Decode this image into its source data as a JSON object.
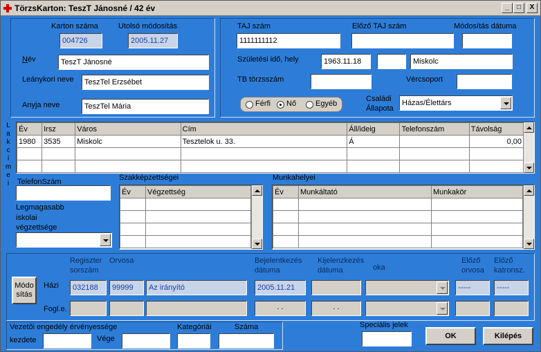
{
  "window": {
    "title": "TörzsKarton: TeszT Jánosné / 42 év",
    "min": "_",
    "max": "□",
    "close": "X"
  },
  "left": {
    "karton_label": "Karton száma",
    "karton_value": "004726",
    "utolso_label": "Utolsó módosítás",
    "utolso_value": "2005.11.27",
    "nev_label": "Név",
    "nev_value": "TeszT Jánosné",
    "leany_label": "Leánykori neve",
    "leany_value": "TeszTel Erzsébet",
    "anyja_label": "Anyja neve",
    "anyja_value": "TeszTel Mária"
  },
  "right": {
    "taj_label": "TAJ szám",
    "taj_value": "1111111112",
    "elozo_taj_label": "Előző TAJ szám",
    "elozo_taj_value": "",
    "mod_datum_label": "Módosítás dátuma",
    "mod_datum_value": "",
    "szul_label": "Születési idő, hely",
    "szul_datum": "1963.11.18",
    "szul_mid": "",
    "szul_hely": "Miskolc",
    "tb_label": "TB törzsszám",
    "tb_value": "",
    "ver_label": "Vércsoport",
    "ver_value": "",
    "radio_ferfi": "Férfi",
    "radio_no": "Nő",
    "radio_egyeb": "Egyéb",
    "csaladi_label1": "Családi",
    "csaladi_label2": "Állapota",
    "csaladi_value": "Házas/Élettárs"
  },
  "lakcimei_label": [
    "L",
    "a",
    "k",
    "c",
    "í",
    "m",
    "e",
    "i"
  ],
  "address_table": {
    "headers": [
      "Év",
      "Irsz",
      "Város",
      "Cím",
      "Áll/ideig",
      "Telefonszám",
      "Távolság"
    ],
    "rows": [
      [
        "1980",
        "3535",
        "Miskolc",
        "Tesztelok u. 33.",
        "Á",
        "",
        "0,00"
      ]
    ]
  },
  "phone": {
    "label": "TelefonSzám",
    "value": ""
  },
  "edu": {
    "label1": "Legmagasabb",
    "label2": "iskolai",
    "label3": "végzettsége",
    "value": ""
  },
  "szakk": {
    "title": "Szakképzettségei",
    "headers": [
      "Év",
      "Végzettség"
    ]
  },
  "munka": {
    "title": "Munkahelyei",
    "headers": [
      "Év",
      "Munkáltató",
      "Munkakör"
    ]
  },
  "regiszter": {
    "mod_btn_1": "Módo",
    "mod_btn_2": "sítás",
    "reg_label1": "Regiszter",
    "reg_label2": "sorszám",
    "orvosa_label": "Orvosa",
    "bej_label1": "Bejelentkezés",
    "bej_label2": "dátuma",
    "kij_label1": "Kijelenzkezés",
    "kij_label2": "dátuma",
    "oka_label": "oka",
    "elozo_orv1": "Előző",
    "elozo_orv2": "orvosa",
    "elozo_kat1": "Előző",
    "elozo_kat2": "katronsz.",
    "hazi_label": "Házi",
    "hazi_reg": "032188",
    "hazi_orv_kod": "99999",
    "hazi_orv_nev": "Az irányító",
    "hazi_bej": "2005.11.21",
    "hazi_kij": "",
    "hazi_elozo_orv": "-----",
    "hazi_elozo_kat": "-----",
    "fogl_label": "Fogl.e.",
    "fogl_bej": ". .",
    "fogl_kij": ". ."
  },
  "vezetoi": {
    "title": "Vezetői engedély érvényessége",
    "kezdete_label": "kezdete",
    "vege_label": "Vége",
    "kat_label": "Kategóriái",
    "szama_label": "Száma"
  },
  "spec_label": "Speciális jelek",
  "ok_btn": "OK",
  "kilepes_btn": "Kilépés"
}
